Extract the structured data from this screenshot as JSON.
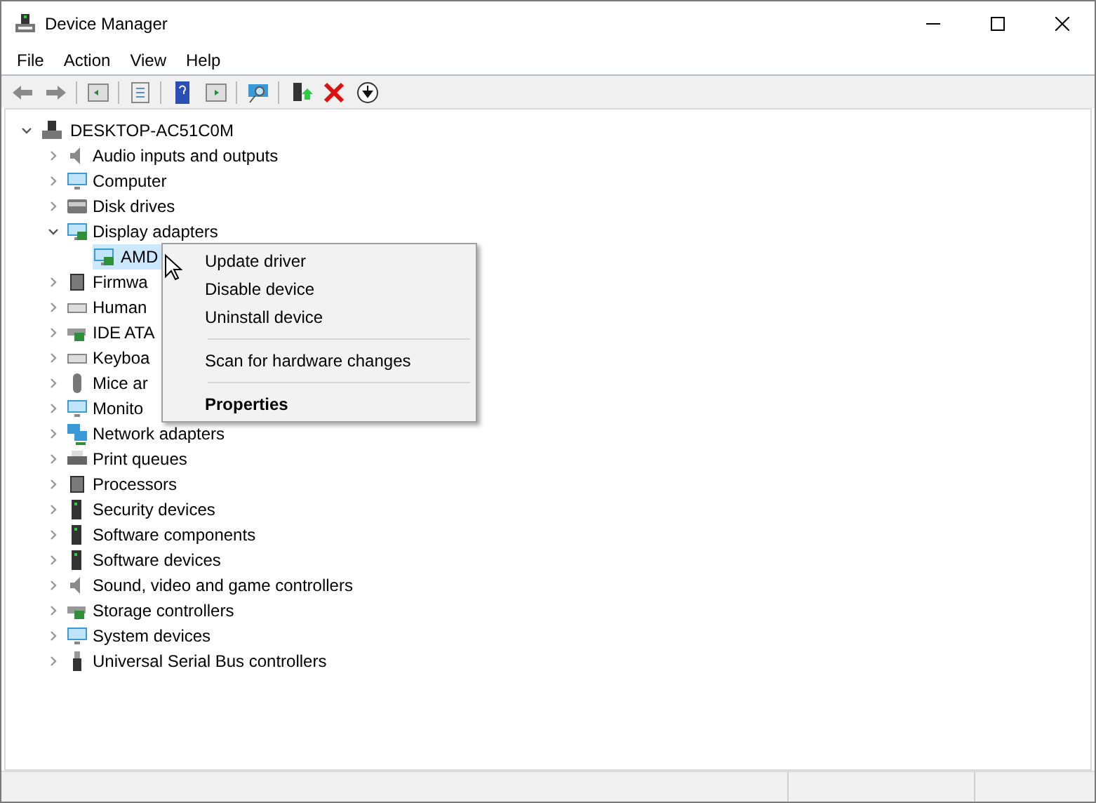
{
  "window": {
    "title": "Device Manager"
  },
  "menu_bar": [
    {
      "label": "File"
    },
    {
      "label": "Action"
    },
    {
      "label": "View"
    },
    {
      "label": "Help"
    }
  ],
  "tree": {
    "label": "DESKTOP-AC51C0M",
    "expanded": true,
    "children": [
      {
        "label": "Audio inputs and outputs",
        "expanded": false
      },
      {
        "label": "Computer",
        "expanded": false
      },
      {
        "label": "Disk drives",
        "expanded": false
      },
      {
        "label": "Display adapters",
        "expanded": true,
        "children": [
          {
            "label": "AMD",
            "selected": true
          }
        ]
      },
      {
        "label": "Firmwa",
        "expanded": false
      },
      {
        "label": "Human",
        "expanded": false
      },
      {
        "label": "IDE ATA",
        "expanded": false
      },
      {
        "label": "Keyboa",
        "expanded": false
      },
      {
        "label": "Mice ar",
        "expanded": false
      },
      {
        "label": "Monito",
        "expanded": false
      },
      {
        "label": "Network adapters",
        "expanded": false
      },
      {
        "label": "Print queues",
        "expanded": false
      },
      {
        "label": "Processors",
        "expanded": false
      },
      {
        "label": "Security devices",
        "expanded": false
      },
      {
        "label": "Software components",
        "expanded": false
      },
      {
        "label": "Software devices",
        "expanded": false
      },
      {
        "label": "Sound, video and game controllers",
        "expanded": false
      },
      {
        "label": "Storage controllers",
        "expanded": false
      },
      {
        "label": "System devices",
        "expanded": false
      },
      {
        "label": "Universal Serial Bus controllers",
        "expanded": false
      }
    ]
  },
  "context_menu": [
    {
      "kind": "item",
      "label": "Update driver",
      "default": false
    },
    {
      "kind": "item",
      "label": "Disable device",
      "default": false
    },
    {
      "kind": "item",
      "label": "Uninstall device",
      "default": false
    },
    {
      "kind": "separator"
    },
    {
      "kind": "item",
      "label": "Scan for hardware changes",
      "default": false
    },
    {
      "kind": "separator"
    },
    {
      "kind": "item",
      "label": "Properties",
      "default": true
    }
  ]
}
